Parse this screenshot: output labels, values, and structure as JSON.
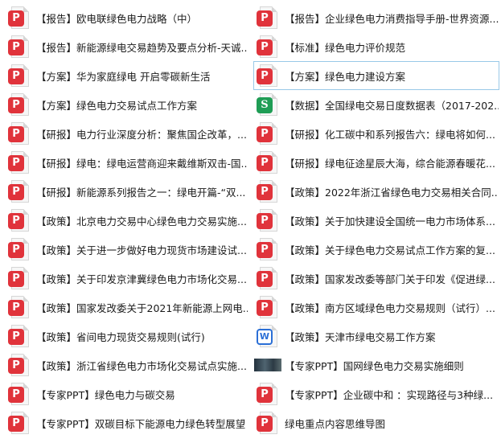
{
  "files": {
    "left": [
      {
        "type": "pdf",
        "name": "【报告】欧电联绿色电力战略（中）"
      },
      {
        "type": "pdf",
        "name": "【报告】新能源绿电交易趋势及要点分析-天诚..."
      },
      {
        "type": "pdf",
        "name": "【方案】华为家庭绿电 开启零碳新生活"
      },
      {
        "type": "pdf",
        "name": "【方案】绿色电力交易试点工作方案"
      },
      {
        "type": "pdf",
        "name": "【研报】电力行业深度分析：聚焦国企改革，..."
      },
      {
        "type": "pdf",
        "name": "【研报】绿电：绿电运营商迎来戴维斯双击-国..."
      },
      {
        "type": "pdf",
        "name": "【研报】新能源系列报告之一：绿电开篇-“双..."
      },
      {
        "type": "pdf",
        "name": "【政策】北京电力交易中心绿色电力交易实施..."
      },
      {
        "type": "pdf",
        "name": "【政策】关于进一步做好电力现货市场建设试..."
      },
      {
        "type": "pdf",
        "name": "【政策】关于印发京津冀绿色电力市场化交易..."
      },
      {
        "type": "pdf",
        "name": "【政策】国家发改委关于2021年新能源上网电..."
      },
      {
        "type": "pdf",
        "name": "【政策】省间电力现货交易规则(试行)"
      },
      {
        "type": "pdf",
        "name": "【政策】浙江省绿色电力市场化交易试点实施..."
      },
      {
        "type": "pdf",
        "name": "【专家PPT】绿色电力与碳交易"
      },
      {
        "type": "pdf",
        "name": "【专家PPT】双碳目标下能源电力绿色转型展望"
      }
    ],
    "right": [
      {
        "type": "pdf",
        "name": "【报告】企业绿色电力消费指导手册-世界资源..."
      },
      {
        "type": "pdf",
        "name": "【标准】绿色电力评价规范"
      },
      {
        "type": "pdf",
        "name": "【方案】绿色电力建设方案",
        "selected": true
      },
      {
        "type": "xls",
        "name": "【数据】全国绿电交易日度数据表（2017-202..."
      },
      {
        "type": "pdf",
        "name": "【研报】化工碳中和系列报告六：绿电将如何..."
      },
      {
        "type": "pdf",
        "name": "【研报】绿电征途星辰大海，综合能源春暖花..."
      },
      {
        "type": "pdf",
        "name": "【政策】2022年浙江省绿色电力交易相关合同..."
      },
      {
        "type": "pdf",
        "name": "【政策】关于加快建设全国统一电力市场体系..."
      },
      {
        "type": "pdf",
        "name": "【政策】关于绿色电力交易试点工作方案的复..."
      },
      {
        "type": "pdf",
        "name": "【政策】国家发改委等部门关于印发《促进绿..."
      },
      {
        "type": "pdf",
        "name": "【政策】南方区域绿色电力交易规则（试行）..."
      },
      {
        "type": "doc",
        "name": "【政策】天津市绿电交易工作方案"
      },
      {
        "type": "img",
        "name": "【专家PPT】国网绿色电力交易实施细则"
      },
      {
        "type": "pdf",
        "name": "【专家PPT】企业碳中和 ：实现路径与3种绿..."
      },
      {
        "type": "pdf",
        "name": "绿电重点内容思维导图"
      }
    ]
  },
  "icons": {
    "pdf": {
      "name": "pdf-file-icon",
      "glyph": "P",
      "color": "#e0333b"
    },
    "xls": {
      "name": "spreadsheet-file-icon",
      "glyph": "S",
      "color": "#1f9d55"
    },
    "doc": {
      "name": "word-file-icon",
      "glyph": "W",
      "color": "#2b6fd6"
    },
    "img": {
      "name": "image-thumbnail-icon",
      "glyph": "",
      "color": "#2c3a44"
    }
  }
}
